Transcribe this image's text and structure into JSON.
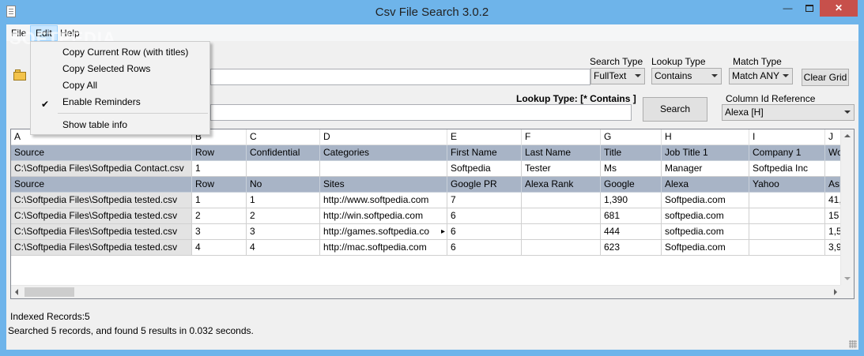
{
  "window": {
    "title": "Csv File Search 3.0.2",
    "minimize": "—",
    "close": "✕"
  },
  "menu": {
    "file": "File",
    "edit": "Edit",
    "help": "Help",
    "edit_items": {
      "copy_current_row": "Copy Current Row (with titles)",
      "copy_selected_rows": "Copy Selected Rows",
      "copy_all": "Copy All",
      "enable_reminders": "Enable Reminders",
      "enable_reminders_checked": true,
      "show_table_info": "Show table info"
    }
  },
  "watermark": "SOFTPEDIA",
  "controls": {
    "search_type_label": "Search Type",
    "search_type_value": "FullText",
    "lookup_type_label": "Lookup Type",
    "lookup_type_value": "Contains",
    "match_type_label": "Match Type",
    "match_type_value": "Match ANY",
    "clear_grid": "Clear Grid",
    "lookup_type_caption": "Lookup Type: [* Contains ]",
    "search_button": "Search",
    "column_id_label": "Column Id Reference",
    "column_id_value": "Alexa [H]",
    "search_text": "",
    "lookup_text": ""
  },
  "grid": {
    "column_letters": [
      "A",
      "B",
      "C",
      "D",
      "E",
      "F",
      "G",
      "H",
      "I",
      "J"
    ],
    "rows": [
      {
        "kind": "header",
        "cells": [
          "Source",
          "Row",
          "Confidential",
          "Categories",
          "First Name",
          "Last Name",
          "Title",
          "Job Title 1",
          "Company 1",
          "Wo"
        ]
      },
      {
        "kind": "data",
        "cells": [
          "C:\\Softpedia Files\\Softpedia Contact.csv",
          "1",
          "",
          "",
          "Softpedia",
          "Tester",
          "Ms",
          "Manager",
          "Softpedia Inc",
          ""
        ]
      },
      {
        "kind": "header",
        "cells": [
          "Source",
          "Row",
          "No",
          "Sites",
          "Google PR",
          "Alexa Rank",
          "Google",
          "Alexa",
          "Yahoo",
          "As"
        ]
      },
      {
        "kind": "data",
        "cells": [
          "C:\\Softpedia Files\\Softpedia tested.csv",
          "1",
          "1",
          "http://www.softpedia.com",
          "7",
          "",
          "1,390",
          "Softpedia.com",
          "",
          "41,"
        ]
      },
      {
        "kind": "data",
        "cells": [
          "C:\\Softpedia Files\\Softpedia tested.csv",
          "2",
          "2",
          "http://win.softpedia.com",
          "6",
          "",
          "681",
          "softpedia.com",
          "",
          "15"
        ]
      },
      {
        "kind": "data",
        "cells": [
          "C:\\Softpedia Files\\Softpedia tested.csv",
          "3",
          "3",
          "http://games.softpedia.co",
          "6",
          "",
          "444",
          "softpedia.com",
          "",
          "1,5"
        ]
      },
      {
        "kind": "data",
        "cells": [
          "C:\\Softpedia Files\\Softpedia tested.csv",
          "4",
          "4",
          "http://mac.softpedia.com",
          "6",
          "",
          "623",
          "Softpedia.com",
          "",
          "3,9"
        ]
      }
    ]
  },
  "status": {
    "indexed": "Indexed Records:5",
    "result": "Searched 5 records, and found 5 results in 0.032 seconds."
  }
}
